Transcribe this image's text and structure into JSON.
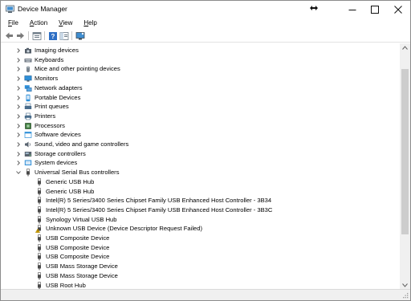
{
  "window": {
    "title": "Device Manager",
    "controls": {
      "minimize": "minimize",
      "maximize": "maximize",
      "close": "close"
    }
  },
  "menu": [
    {
      "label": "File",
      "accel": "F",
      "rest": "ile"
    },
    {
      "label": "Action",
      "accel": "A",
      "rest": "ction"
    },
    {
      "label": "View",
      "accel": "V",
      "rest": "iew"
    },
    {
      "label": "Help",
      "accel": "H",
      "rest": "elp"
    }
  ],
  "toolbar": [
    {
      "name": "back",
      "icon": "back-arrow-icon"
    },
    {
      "name": "forward",
      "icon": "forward-arrow-icon"
    },
    {
      "name": "properties",
      "icon": "properties-icon"
    },
    {
      "name": "help",
      "icon": "help-icon"
    },
    {
      "name": "show-hide-console-tree",
      "icon": "console-tree-icon"
    },
    {
      "name": "scan-hardware",
      "icon": "monitor-scan-icon"
    }
  ],
  "tree": {
    "categories": [
      {
        "label": "Imaging devices",
        "icon": "camera-icon",
        "color": "#555f6a",
        "expanded": false
      },
      {
        "label": "Keyboards",
        "icon": "keyboard-icon",
        "color": "#6e7681",
        "expanded": false
      },
      {
        "label": "Mice and other pointing devices",
        "icon": "mouse-icon",
        "color": "#7a8590",
        "expanded": false
      },
      {
        "label": "Monitors",
        "icon": "monitor-icon",
        "color": "#2f8fd8",
        "expanded": false
      },
      {
        "label": "Network adapters",
        "icon": "network-adapter-icon",
        "color": "#2f8fd8",
        "expanded": false
      },
      {
        "label": "Portable Devices",
        "icon": "portable-device-icon",
        "color": "#2f8fd8",
        "expanded": false
      },
      {
        "label": "Print queues",
        "icon": "print-queue-icon",
        "color": "#4a6d8c",
        "expanded": false
      },
      {
        "label": "Printers",
        "icon": "printer-icon",
        "color": "#4a6d8c",
        "expanded": false
      },
      {
        "label": "Processors",
        "icon": "processor-icon",
        "color": "#3b7a3b",
        "expanded": false
      },
      {
        "label": "Software devices",
        "icon": "software-device-icon",
        "color": "#2f8fd8",
        "expanded": false
      },
      {
        "label": "Sound, video and game controllers",
        "icon": "speaker-icon",
        "color": "#5a6470",
        "expanded": false
      },
      {
        "label": "Storage controllers",
        "icon": "storage-controller-icon",
        "color": "#5a6470",
        "expanded": false
      },
      {
        "label": "System devices",
        "icon": "system-device-icon",
        "color": "#2f8fd8",
        "expanded": false
      },
      {
        "label": "Universal Serial Bus controllers",
        "icon": "usb-icon",
        "color": "#5a6470",
        "expanded": true
      }
    ],
    "usb_children": [
      {
        "label": "Generic USB Hub",
        "icon": "usb-plug-icon",
        "warning": false
      },
      {
        "label": "Generic USB Hub",
        "icon": "usb-plug-icon",
        "warning": false
      },
      {
        "label": "Intel(R) 5 Series/3400 Series Chipset Family USB Enhanced Host Controller - 3B34",
        "icon": "usb-plug-icon",
        "warning": false
      },
      {
        "label": "Intel(R) 5 Series/3400 Series Chipset Family USB Enhanced Host Controller - 3B3C",
        "icon": "usb-plug-icon",
        "warning": false
      },
      {
        "label": "Synology Virtual USB Hub",
        "icon": "usb-plug-icon",
        "warning": false
      },
      {
        "label": "Unknown USB Device (Device Descriptor Request Failed)",
        "icon": "warning-usb-icon",
        "warning": true
      },
      {
        "label": "USB Composite Device",
        "icon": "usb-plug-icon",
        "warning": false
      },
      {
        "label": "USB Composite Device",
        "icon": "usb-plug-icon",
        "warning": false
      },
      {
        "label": "USB Composite Device",
        "icon": "usb-plug-icon",
        "warning": false
      },
      {
        "label": "USB Mass Storage Device",
        "icon": "usb-plug-icon",
        "warning": false
      },
      {
        "label": "USB Mass Storage Device",
        "icon": "usb-plug-icon",
        "warning": false
      },
      {
        "label": "USB Root Hub",
        "icon": "usb-plug-icon",
        "warning": false
      }
    ]
  },
  "scrollbar": {
    "position": 0.28,
    "visible_fraction": 0.72
  },
  "colors": {
    "accent": "#2f8fd8",
    "warning": "#e8b400",
    "scroll_thumb": "#cdcdcd"
  }
}
